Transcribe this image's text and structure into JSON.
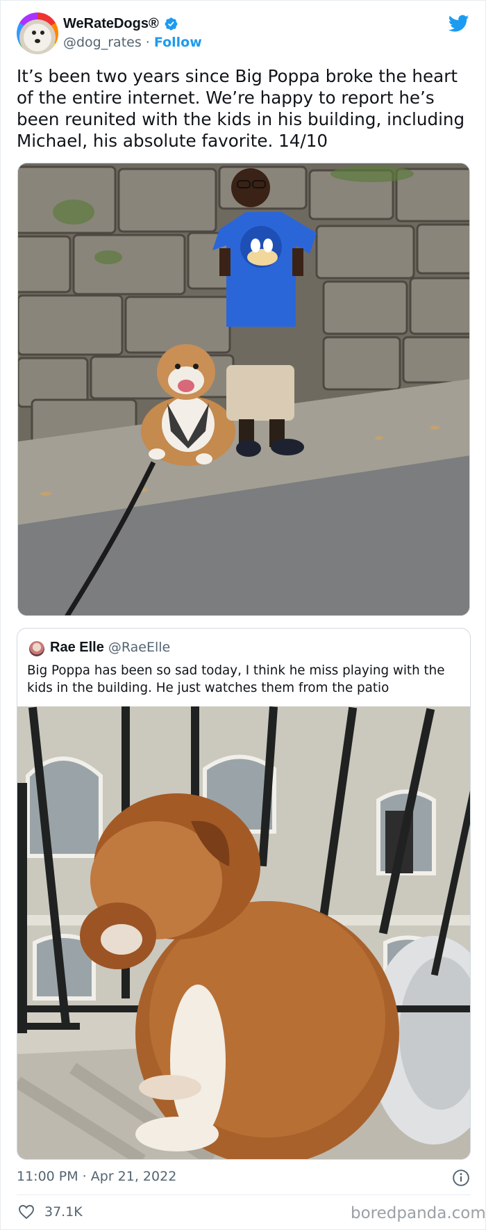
{
  "author": {
    "display_name": "WeRateDogs®",
    "handle": "@dog_rates",
    "separator": " · ",
    "follow_label": "Follow"
  },
  "tweet": {
    "text": "It’s been two years since Big Poppa broke the heart of the entire internet. We’re happy to report he’s been reunited with the kids in his building, including Michael, his absolute favorite. 14/10",
    "timestamp": "11:00 PM · Apr 21, 2022",
    "like_count": "37.1K"
  },
  "quoted_tweet": {
    "display_name": "Rae Elle",
    "handle": "@RaeElle",
    "text": "Big Poppa has been so sad today, I think he miss playing with the kids in the building.  He just watches them from the patio"
  },
  "watermark": "boredpanda.com",
  "icons": {
    "verified": "verified-badge-icon",
    "twitter": "twitter-bird-icon",
    "info": "info-icon",
    "like": "heart-icon"
  },
  "colors": {
    "accent": "#1d9bf0",
    "secondary_text": "#536471",
    "primary_text": "#0f1419",
    "border": "#cfd9de"
  }
}
